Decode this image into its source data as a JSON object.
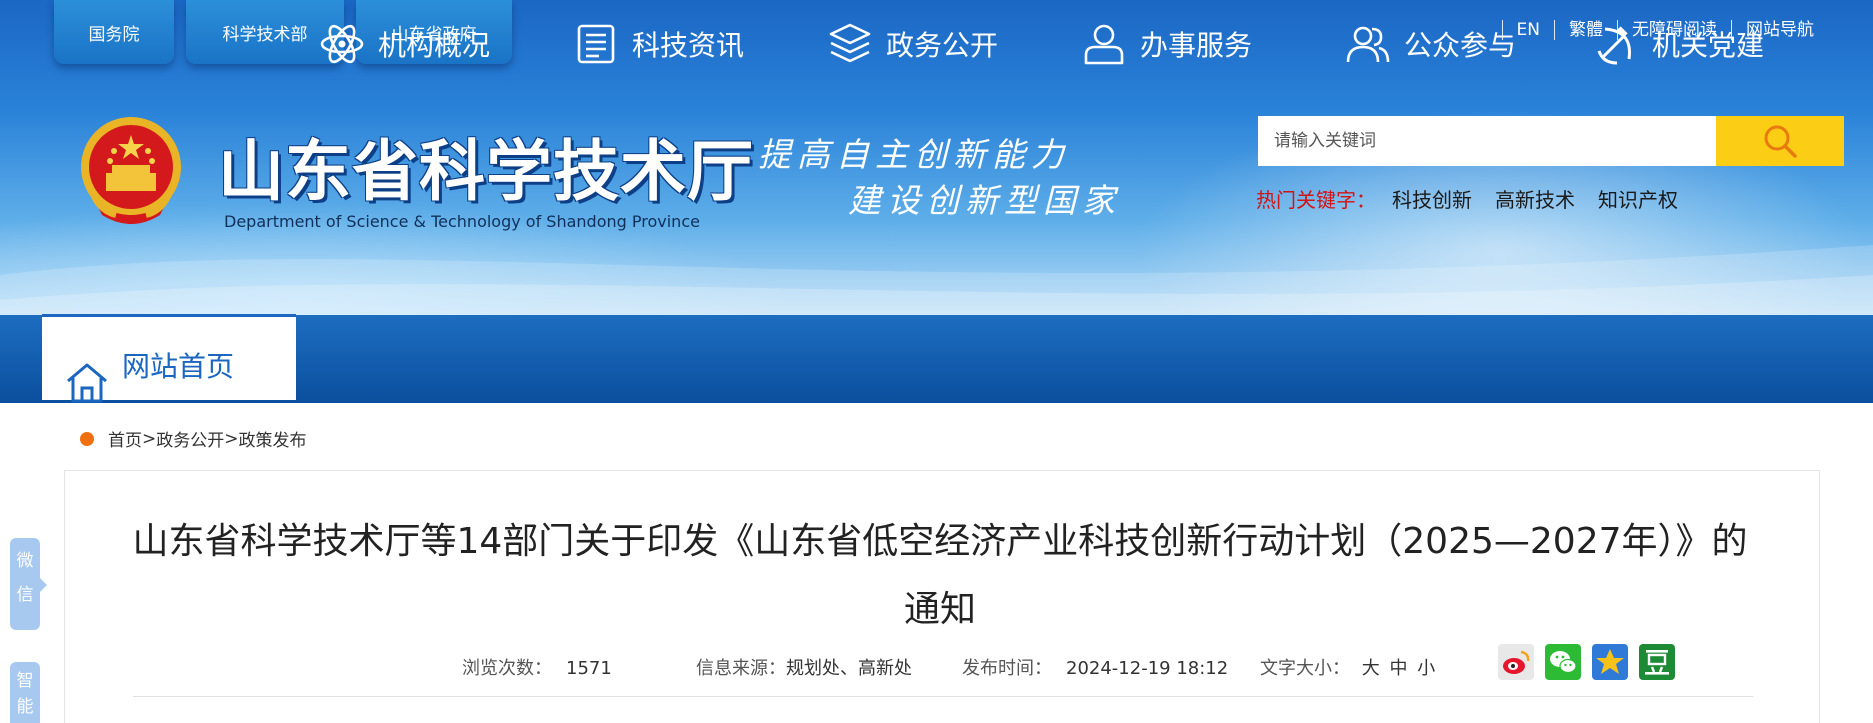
{
  "gov_links": [
    "国务院",
    "科学技术部",
    "山东省政府"
  ],
  "top_links": [
    "EN",
    "繁體",
    "无障碍阅读",
    "网站导航"
  ],
  "site": {
    "title": "山东省科学技术厅",
    "subtitle": "Department of Science & Technology of Shandong Province",
    "slogan_line1": "提高自主创新能力",
    "slogan_line2": "建设创新型国家"
  },
  "search": {
    "placeholder": "请输入关键词",
    "hot_label": "热门关键字：",
    "hot_keywords": [
      "科技创新",
      "高新技术",
      "知识产权"
    ]
  },
  "nav": [
    {
      "label": "网站首页",
      "icon": "home-icon"
    },
    {
      "label": "机构概况",
      "icon": "atom-icon"
    },
    {
      "label": "科技资讯",
      "icon": "document-icon"
    },
    {
      "label": "政务公开",
      "icon": "layers-icon"
    },
    {
      "label": "办事服务",
      "icon": "user-icon"
    },
    {
      "label": "公众参与",
      "icon": "users-icon"
    },
    {
      "label": "机关党建",
      "icon": "party-emblem-icon"
    }
  ],
  "breadcrumb": {
    "home": "首页",
    "sep1": ">",
    "level1": "政务公开",
    "sep2": ">",
    "level2": "政策发布"
  },
  "article": {
    "title_line1": "山东省科学技术厅等14部门关于印发《山东省低空经济产业科技创新行动计划（2025—2027年）》的",
    "title_line2": "通知",
    "views_label": "浏览次数：",
    "views": "1571",
    "source_label": "信息来源：",
    "source": "规划处、高新处",
    "date_label": "发布时间：",
    "date": "2024-12-19 18:12",
    "fontsize_label": "文字大小：",
    "font_sizes": [
      "大",
      "中",
      "小"
    ]
  },
  "share_icons": [
    "weibo-icon",
    "wechat-icon",
    "qzone-icon",
    "douban-icon"
  ],
  "side_tags": {
    "wechat": "微信",
    "smart": "智能问"
  },
  "colors": {
    "header_blue": "#1b67c4",
    "nav_blue": "#0b4f9e",
    "search_button": "#fccd15",
    "hot_label_red": "#d11414",
    "breadcrumb_dot": "#f06f10"
  }
}
